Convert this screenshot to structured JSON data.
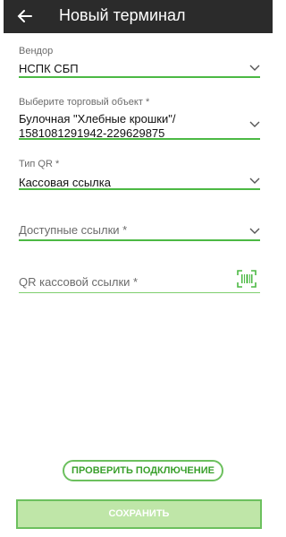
{
  "header": {
    "title": "Новый терминал",
    "back_icon": "arrow-left-icon"
  },
  "form": {
    "vendor": {
      "label": "Вендор",
      "value": "НСПК СБП"
    },
    "merchant": {
      "label": "Выберите торговый объект *",
      "value_line1": "Булочная \"Хлебные крошки\"/",
      "value_line2": "1581081291942-229629875"
    },
    "qr_type": {
      "label": "Тип QR *",
      "value": "Кассовая ссылка"
    },
    "links": {
      "placeholder": "Доступные ссылки *"
    },
    "qr_link": {
      "placeholder": "QR кассовой ссылки *",
      "icon": "qr-scan-icon"
    }
  },
  "actions": {
    "check_label": "ПРОВЕРИТЬ ПОДКЛЮЧЕНИЕ",
    "save_label": "СОХРАНИТЬ"
  },
  "colors": {
    "accent": "#4cb944",
    "appbar": "#2b2b2b",
    "save_bg": "#bfe6a8"
  }
}
